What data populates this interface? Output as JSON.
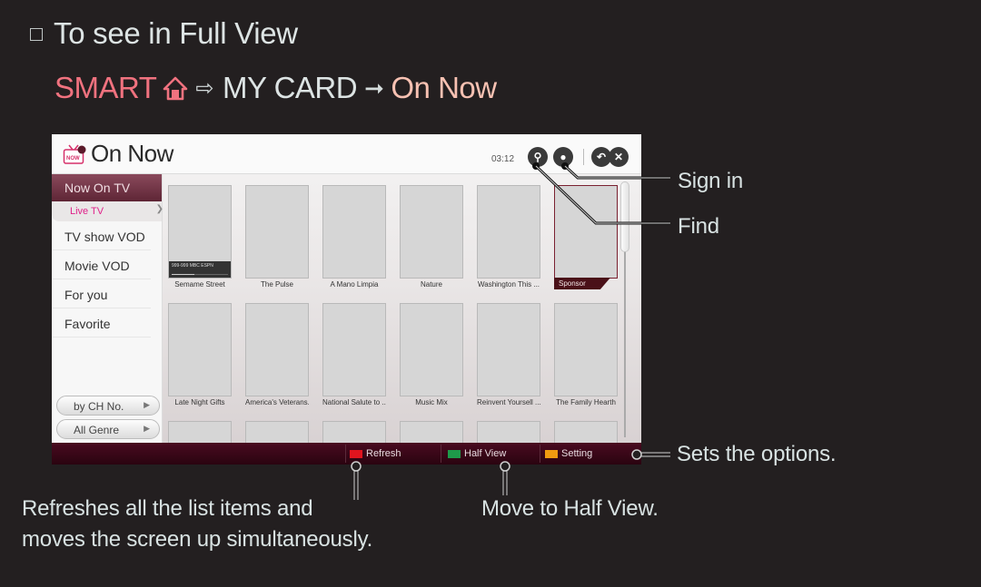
{
  "heading": {
    "bullet": "checkbox-square",
    "text": "To see in Full View"
  },
  "path": {
    "smart": "SMART",
    "home_icon": "home-icon",
    "arrow1": "⇨",
    "mycard": "MY CARD",
    "arrow2": "➞",
    "onnow": "On Now",
    "colors": {
      "smart": "#f0727f",
      "onnow": "#f7c1b2"
    }
  },
  "tv": {
    "title": "On Now",
    "time": "03:12",
    "header_icons": [
      "search-icon",
      "user-icon",
      "back-icon",
      "close-icon"
    ],
    "sidebar": {
      "active": "Now On TV",
      "sub_item": "Live TV",
      "items": [
        "TV show VOD",
        "Movie VOD",
        "For you",
        "Favorite"
      ],
      "sort_buttons": [
        "by CH No.",
        "All Genre"
      ]
    },
    "rows": [
      [
        {
          "title": "Semame Street",
          "live_info": "999-999 MBC ESPN"
        },
        {
          "title": "The Pulse"
        },
        {
          "title": "A Mano Limpia"
        },
        {
          "title": "Nature"
        },
        {
          "title": "Washington This ..."
        },
        {
          "title": "Sponsor",
          "selected": true
        }
      ],
      [
        {
          "title": "Late Night Gifts"
        },
        {
          "title": "America's Veterans..."
        },
        {
          "title": "National Salute to ..."
        },
        {
          "title": "Music Mix"
        },
        {
          "title": "Reinvent Yoursell ..."
        },
        {
          "title": "The Family Hearth"
        }
      ]
    ],
    "footer": {
      "refresh": "Refresh",
      "half_view": "Half View",
      "setting": "Setting",
      "key_colors": {
        "refresh": "#e0141e",
        "half_view": "#1e9a4a",
        "setting": "#f09a10"
      }
    },
    "accent": "#5e2535"
  },
  "callouts": {
    "sign_in": "Sign in",
    "find": "Find",
    "sets_options": "Sets the options.",
    "refresh_desc_line1": "Refreshes all the list items and",
    "refresh_desc_line2": "moves the screen up simultaneously.",
    "half_view_desc": "Move to Half View."
  }
}
